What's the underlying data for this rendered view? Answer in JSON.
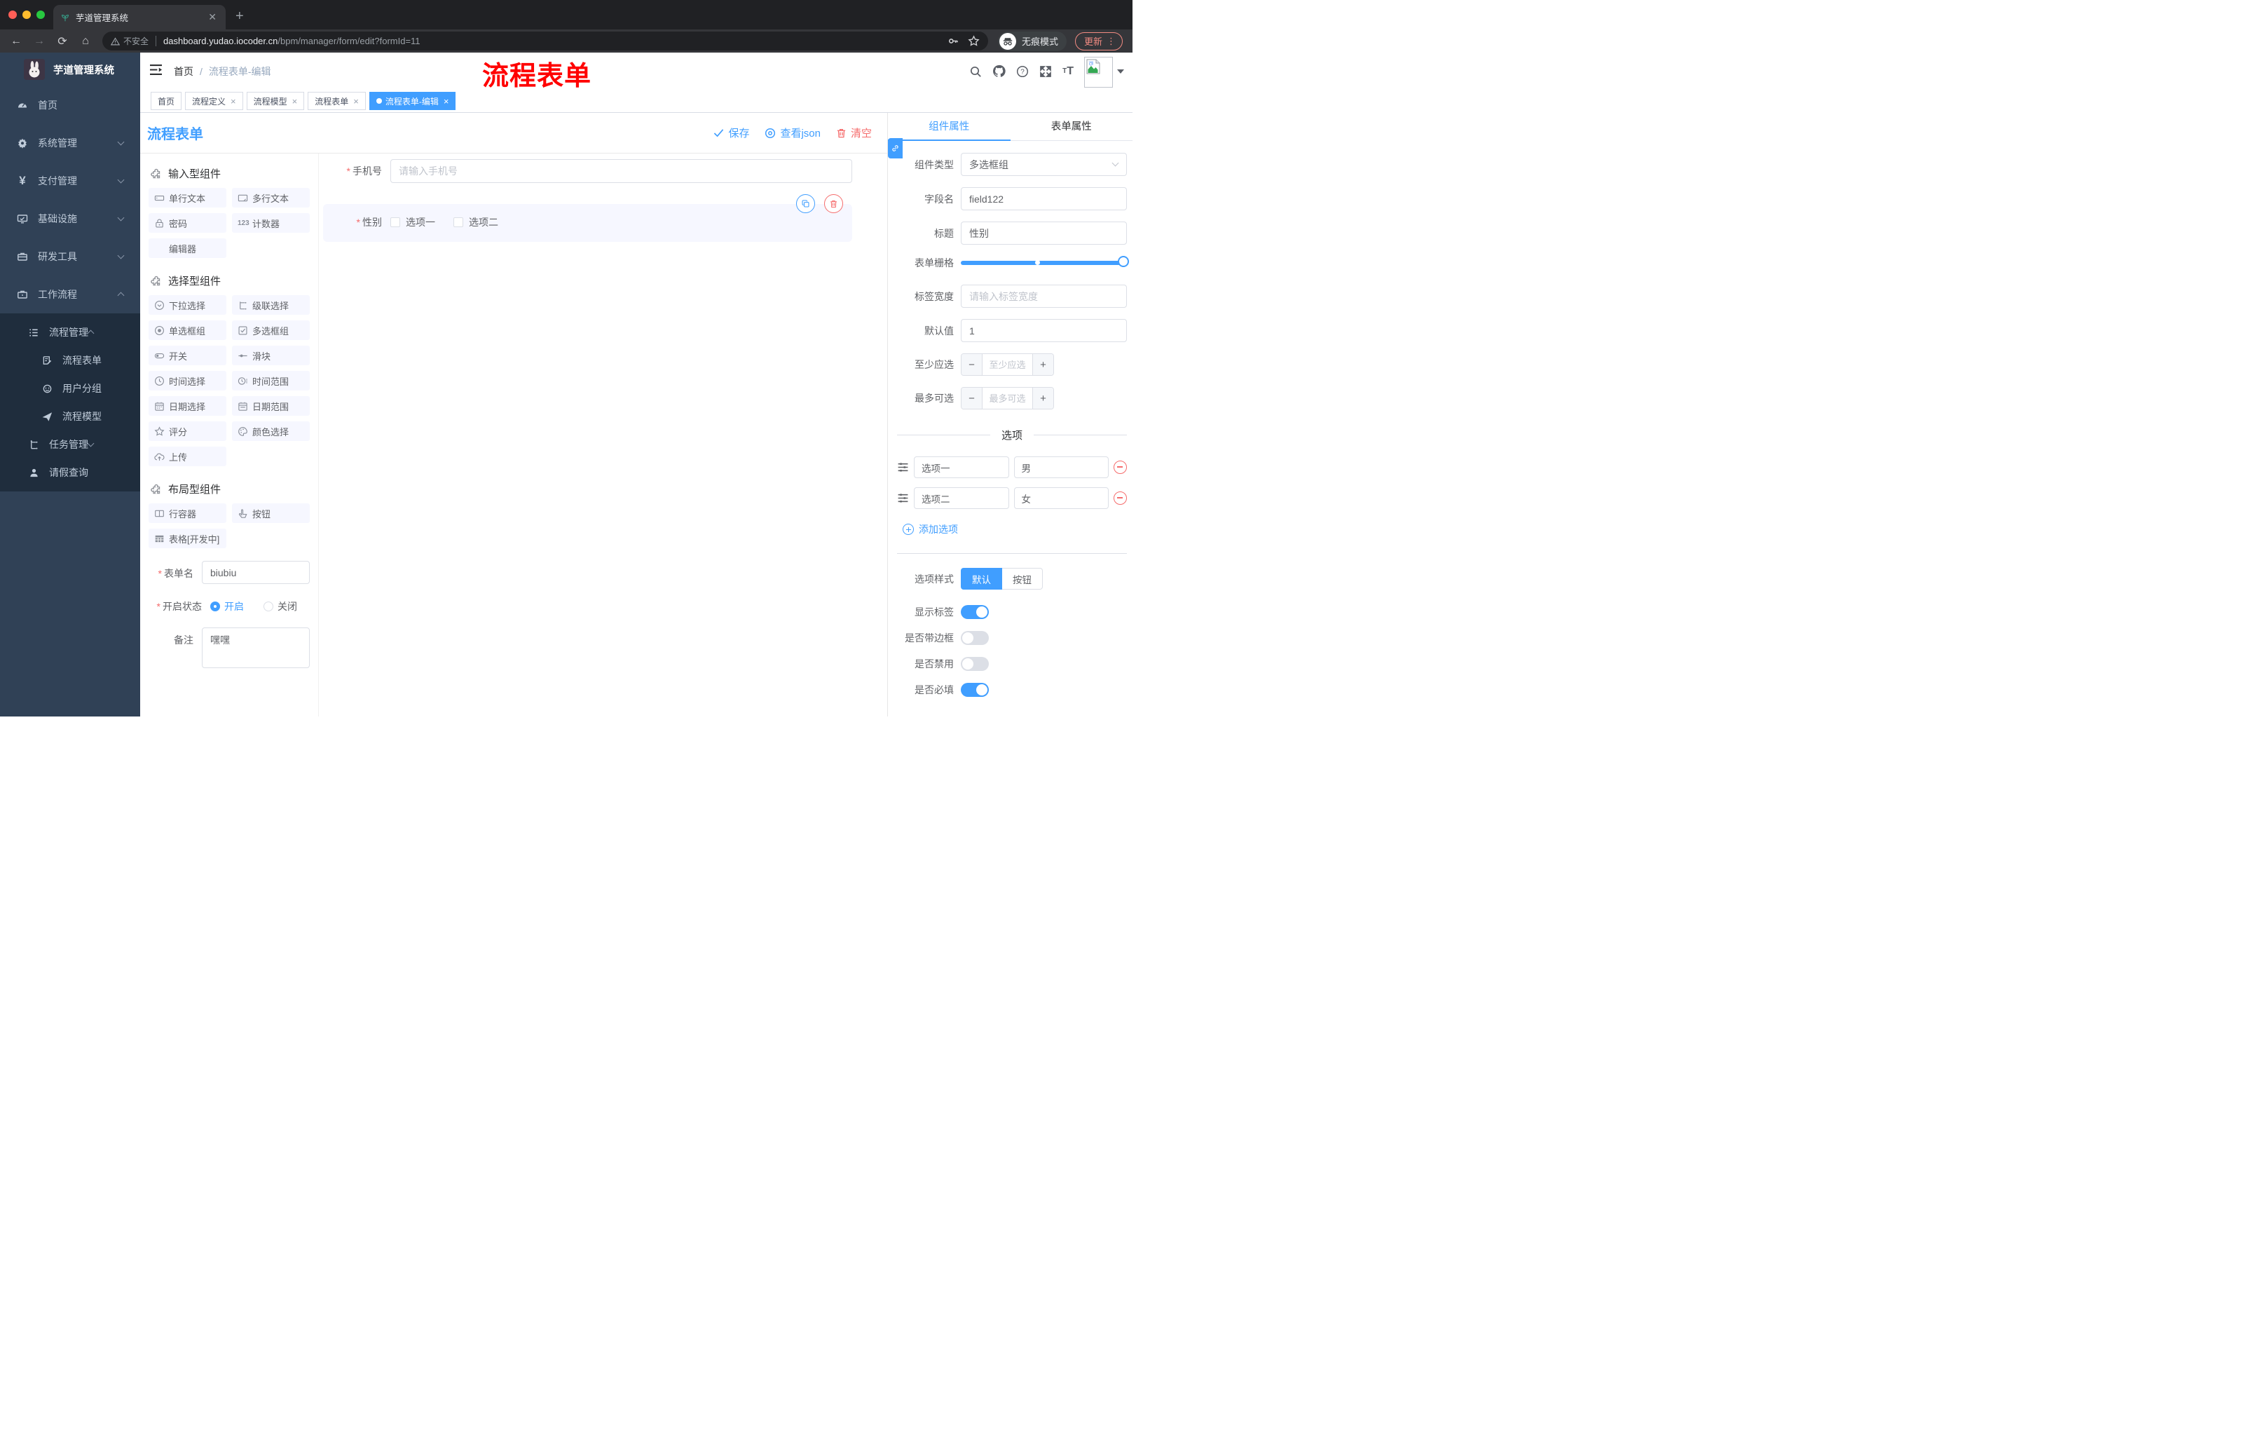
{
  "browser": {
    "tab_title": "芋道管理系统",
    "security": "不安全",
    "domain": "dashboard.yudao.iocoder.cn",
    "path": "/bpm/manager/form/edit?formId=11",
    "incognito": "无痕模式",
    "update": "更新"
  },
  "sidebar": {
    "title": "芋道管理系统",
    "menu": [
      "首页",
      "系统管理",
      "支付管理",
      "基础设施",
      "研发工具",
      "工作流程",
      "流程管理",
      "流程表单",
      "用户分组",
      "流程模型",
      "任务管理",
      "请假查询"
    ]
  },
  "header": {
    "breadcrumb_home": "首页",
    "breadcrumb_current": "流程表单-编辑",
    "annotation": "流程表单"
  },
  "tags": [
    "首页",
    "流程定义",
    "流程模型",
    "流程表单",
    "流程表单-编辑"
  ],
  "toolbar": {
    "title": "流程表单",
    "save": "保存",
    "view_json": "查看json",
    "clear": "清空"
  },
  "components": {
    "section_input": "输入型组件",
    "input_items": [
      "单行文本",
      "多行文本",
      "密码",
      "计数器",
      "编辑器"
    ],
    "section_select": "选择型组件",
    "select_items": [
      "下拉选择",
      "级联选择",
      "单选框组",
      "多选框组",
      "开关",
      "滑块",
      "时间选择",
      "时间范围",
      "日期选择",
      "日期范围",
      "评分",
      "颜色选择",
      "上传"
    ],
    "section_layout": "布局型组件",
    "layout_items": [
      "行容器",
      "按钮",
      "表格[开发中]"
    ]
  },
  "form_meta": {
    "name_label": "表单名",
    "name_value": "biubiu",
    "status_label": "开启状态",
    "status_on": "开启",
    "status_off": "关闭",
    "remark_label": "备注",
    "remark_value": "嘿嘿"
  },
  "canvas": {
    "phone_label": "手机号",
    "phone_placeholder": "请输入手机号",
    "gender_label": "性别",
    "gender_opt1": "选项一",
    "gender_opt2": "选项二"
  },
  "props": {
    "tab_component": "组件属性",
    "tab_form": "表单属性",
    "type_label": "组件类型",
    "type_value": "多选框组",
    "field_label": "字段名",
    "field_value": "field122",
    "title_label": "标题",
    "title_value": "性别",
    "grid_label": "表单栅格",
    "label_width_label": "标签宽度",
    "label_width_placeholder": "请输入标签宽度",
    "default_label": "默认值",
    "default_value": "1",
    "min_label": "至少应选",
    "min_placeholder": "至少应选",
    "max_label": "最多可选",
    "max_placeholder": "最多可选",
    "options_title": "选项",
    "options": [
      {
        "label": "选项一",
        "value": "男"
      },
      {
        "label": "选项二",
        "value": "女"
      }
    ],
    "add_option": "添加选项",
    "style_label": "选项样式",
    "style_default": "默认",
    "style_button": "按钮",
    "toggle_show_label": "显示标签",
    "toggle_border": "是否带边框",
    "toggle_disabled": "是否禁用",
    "toggle_required": "是否必填"
  },
  "colors": {
    "primary": "#409eff",
    "danger": "#f56c6c",
    "sidebar_bg": "#304156",
    "submenu_bg": "#1f2d3d",
    "chrome_dark": "#202124",
    "chrome_toolbar": "#35363a"
  }
}
